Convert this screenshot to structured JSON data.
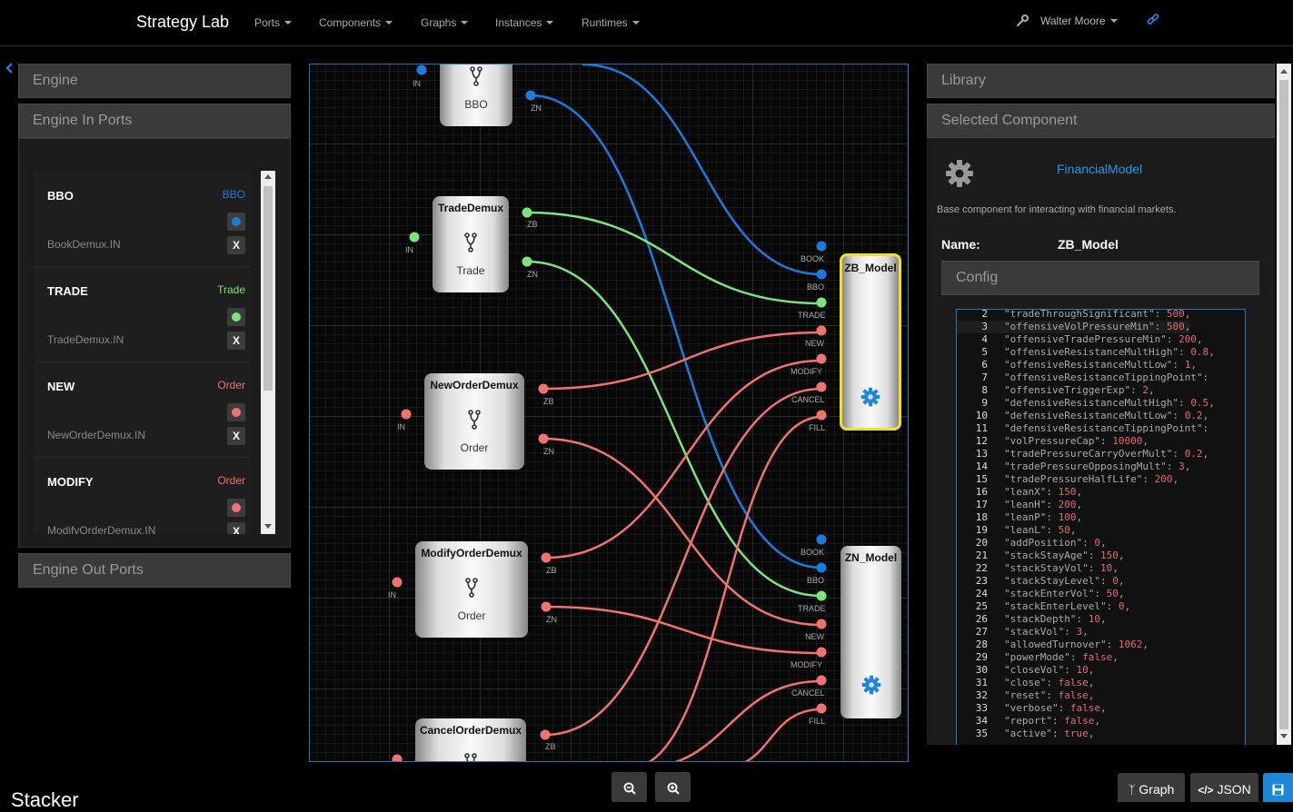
{
  "nav": {
    "brand": "Strategy Lab",
    "menus": [
      "Ports",
      "Components",
      "Graphs",
      "Instances",
      "Runtimes"
    ],
    "user": "Walter Moore"
  },
  "left": {
    "engine": "Engine",
    "in_ports": "Engine In Ports",
    "out_ports": "Engine Out Ports",
    "ports": [
      {
        "name": "BBO",
        "type": "BBO",
        "color": "#1e7ad8",
        "target": "BookDemux.IN",
        "remove": "X"
      },
      {
        "name": "TRADE",
        "type": "Trade",
        "color": "#7ee27e",
        "target": "TradeDemux.IN",
        "remove": "X"
      },
      {
        "name": "NEW",
        "type": "Order",
        "color": "#f07272",
        "target": "NewOrderDemux.IN",
        "remove": "X"
      },
      {
        "name": "MODIFY",
        "type": "Order",
        "color": "#f07272",
        "target": "ModifyOrderDemux.IN",
        "remove": "X"
      }
    ]
  },
  "graph": {
    "nodes": [
      {
        "title": "",
        "sub": "BBO"
      },
      {
        "title": "TradeDemux",
        "sub": "Trade"
      },
      {
        "title": "NewOrderDemux",
        "sub": "Order"
      },
      {
        "title": "ModifyOrderDemux",
        "sub": "Order"
      },
      {
        "title": "CancelOrderDemux",
        "sub": ""
      },
      {
        "title": "ZB_Model",
        "sub": ""
      },
      {
        "title": "ZN_Model",
        "sub": ""
      }
    ],
    "labels": {
      "in": "IN",
      "zb": "ZB",
      "zn": "ZN",
      "book": "BOOK",
      "bbo": "BBO",
      "trade": "TRADE",
      "new": "NEW",
      "modify": "MODIFY",
      "cancel": "CANCEL",
      "fill": "FILL"
    },
    "colors": {
      "blue": "#1e7ad8",
      "green": "#7ee27e",
      "red": "#f07272",
      "selected": "#f0e02a"
    }
  },
  "right": {
    "library": "Library",
    "selected": "Selected Component",
    "component_link": "FinancialModel",
    "description": "Base component for interacting with financial markets.",
    "name_label": "Name:",
    "name_value": "ZB_Model",
    "config": "Config",
    "code": [
      [
        "2",
        "\"tradeThroughSignificant\"",
        "500"
      ],
      [
        "3",
        "\"offensiveVolPressureMin\"",
        "500"
      ],
      [
        "4",
        "\"offensiveTradePressureMin\"",
        "200"
      ],
      [
        "5",
        "\"offensiveResistanceMultHigh\"",
        "0.8"
      ],
      [
        "6",
        "\"offensiveResistanceMultLow\"",
        "1"
      ],
      [
        "7",
        "\"offensiveResistanceTippingPoint\"",
        ""
      ],
      [
        "8",
        "\"offensiveTriggerExp\"",
        "2"
      ],
      [
        "9",
        "\"defensiveResistanceMultHigh\"",
        "0.5"
      ],
      [
        "10",
        "\"defensiveResistanceMultLow\"",
        "0.2"
      ],
      [
        "11",
        "\"defensiveResistanceTippingPoint\"",
        ""
      ],
      [
        "12",
        "\"volPressureCap\"",
        "10000"
      ],
      [
        "13",
        "\"tradePressureCarryOverMult\"",
        "0.2"
      ],
      [
        "14",
        "\"tradePressureOpposingMult\"",
        "3"
      ],
      [
        "15",
        "\"tradePressureHalfLife\"",
        "200"
      ],
      [
        "16",
        "\"leanX\"",
        "150"
      ],
      [
        "17",
        "\"leanH\"",
        "200"
      ],
      [
        "18",
        "\"leanP\"",
        "100"
      ],
      [
        "19",
        "\"leanL\"",
        "50"
      ],
      [
        "20",
        "\"addPosition\"",
        "0"
      ],
      [
        "21",
        "\"stackStayAge\"",
        "150"
      ],
      [
        "22",
        "\"stackStayVol\"",
        "10"
      ],
      [
        "23",
        "\"stackStayLevel\"",
        "0"
      ],
      [
        "24",
        "\"stackEnterVol\"",
        "50"
      ],
      [
        "25",
        "\"stackEnterLevel\"",
        "0"
      ],
      [
        "26",
        "\"stackDepth\"",
        "10"
      ],
      [
        "27",
        "\"stackVol\"",
        "3"
      ],
      [
        "28",
        "\"allowedTurnover\"",
        "1062"
      ],
      [
        "29",
        "\"powerMode\"",
        "false"
      ],
      [
        "30",
        "\"closeVol\"",
        "10"
      ],
      [
        "31",
        "\"close\"",
        "false"
      ],
      [
        "32",
        "\"reset\"",
        "false"
      ],
      [
        "33",
        "\"verbose\"",
        "false"
      ],
      [
        "34",
        "\"report\"",
        "false"
      ],
      [
        "35",
        "\"active\"",
        "true"
      ]
    ]
  },
  "footer": {
    "title": "Stacker",
    "graph_btn": "Graph",
    "json_btn": "JSON"
  }
}
